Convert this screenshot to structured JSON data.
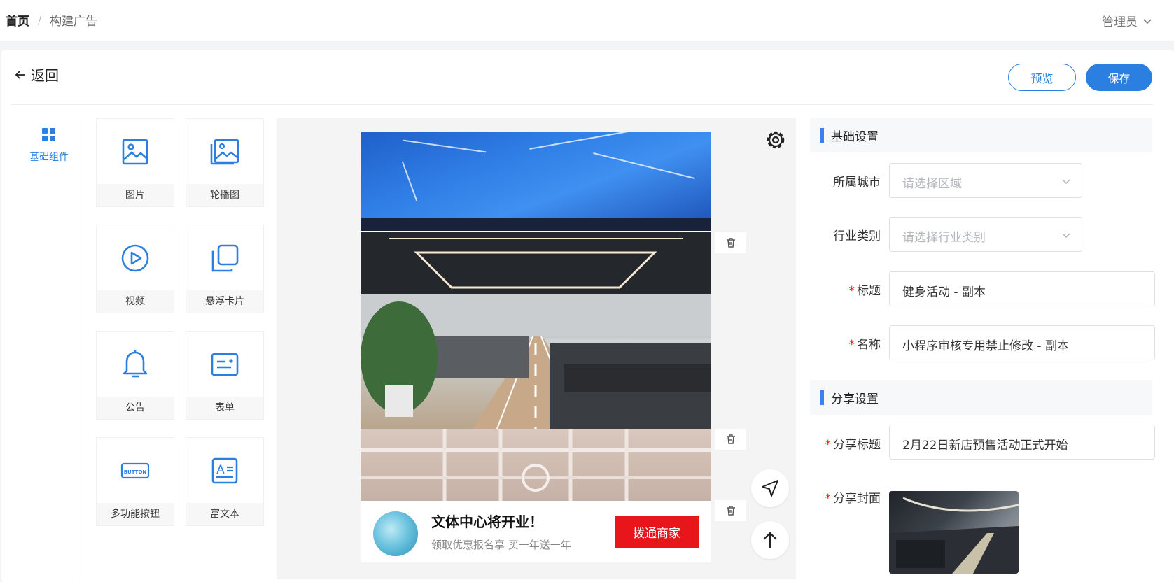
{
  "breadcrumb": {
    "home": "首页",
    "separator": "/",
    "current": "构建广告"
  },
  "user": {
    "name": "管理员"
  },
  "toolbar": {
    "back_label": "返回",
    "preview_label": "预览",
    "save_label": "保存"
  },
  "sidebar": {
    "category_label": "基础组件"
  },
  "components": [
    {
      "label": "图片",
      "icon": "image-icon"
    },
    {
      "label": "轮播图",
      "icon": "carousel-icon"
    },
    {
      "label": "视频",
      "icon": "video-icon"
    },
    {
      "label": "悬浮卡片",
      "icon": "floating-card-icon"
    },
    {
      "label": "公告",
      "icon": "bell-icon"
    },
    {
      "label": "表单",
      "icon": "form-icon"
    },
    {
      "label": "多功能按钮",
      "icon": "button-icon"
    },
    {
      "label": "富文本",
      "icon": "richtext-icon"
    }
  ],
  "preview": {
    "ad_title": "文体中心将开业！",
    "ad_subtitle": "领取优惠报名享 买一年送一年",
    "ad_button": "拨通商家",
    "button_icon_text": "BUTTON",
    "richtext_icon_text": "A"
  },
  "settings": {
    "basic_title": "基础设置",
    "city_label": "所属城市",
    "city_placeholder": "请选择区域",
    "industry_label": "行业类别",
    "industry_placeholder": "请选择行业类别",
    "title_label": "标题",
    "title_value": "健身活动 - 副本",
    "name_label": "名称",
    "name_value": "小程序审核专用禁止修改 - 副本",
    "share_title": "分享设置",
    "share_title_label": "分享标题",
    "share_title_value": "2月22日新店预售活动正式开始",
    "share_cover_label": "分享封面",
    "required_mark": "*"
  },
  "colors": {
    "accent": "#2b7fe0",
    "danger": "#e8161b",
    "section_bar": "#3d7ff0"
  }
}
